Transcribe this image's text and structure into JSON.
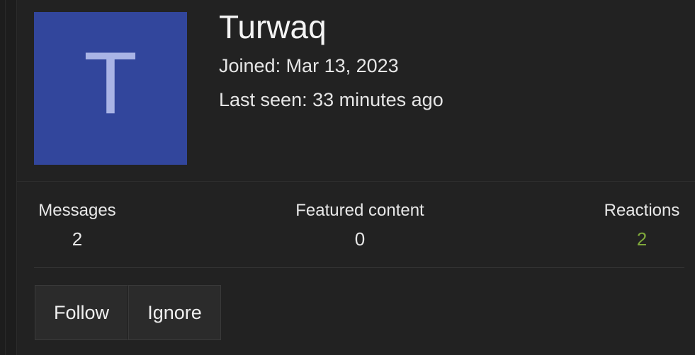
{
  "profile": {
    "avatar_letter": "T",
    "avatar_color": "#32469c",
    "username": "Turwaq",
    "joined": "Joined: Mar 13, 2023",
    "last_seen": "Last seen: 33 minutes ago"
  },
  "stats": [
    {
      "label": "Messages",
      "value": "2"
    },
    {
      "label": "Featured content",
      "value": "0"
    },
    {
      "label": "Reactions",
      "value": "2"
    }
  ],
  "accent_colors": {
    "reactions_value": "#7fa83b"
  },
  "actions": {
    "follow_label": "Follow",
    "ignore_label": "Ignore"
  }
}
